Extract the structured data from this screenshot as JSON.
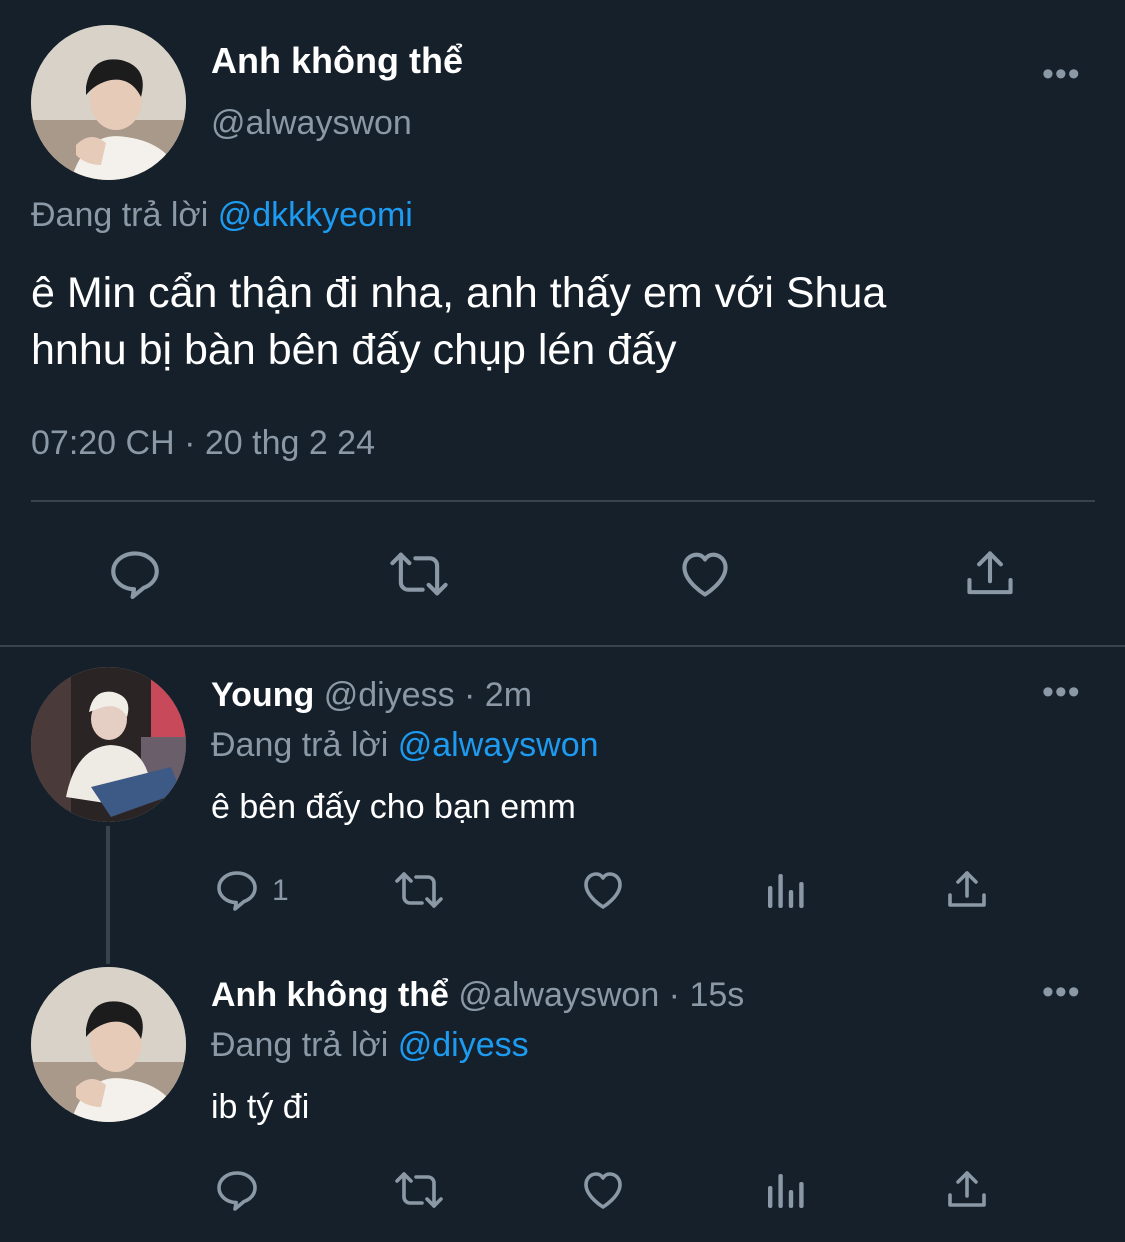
{
  "main_tweet": {
    "display_name": "Anh không thể",
    "handle": "@alwayswon",
    "replying_prefix": "Đang trả lời",
    "replying_to": "@dkkkyeomi",
    "text_line1": "ê Min cẩn thận đi nha, anh thấy em với Shua",
    "text_line2": "hnhu bị bàn bên đấy chụp lén đấy",
    "timestamp": "07:20 CH · 20 thg 2 24",
    "more_label": "•••"
  },
  "reply1": {
    "display_name": "Young",
    "meta": "@diyess · 2m",
    "replying_prefix": "Đang trả lời",
    "replying_to": "@alwayswon",
    "text": "ê bên đấy cho bạn emm",
    "reply_count": "1",
    "more_label": "•••"
  },
  "reply2": {
    "display_name": "Anh không thể",
    "meta": "@alwayswon · 15s",
    "replying_prefix": "Đang trả lời",
    "replying_to": "@diyess",
    "text": "ib tý đi",
    "more_label": "•••"
  },
  "colors": {
    "background": "#15202b",
    "muted": "#8b98a5",
    "link": "#1d9bf0",
    "divider": "#38444d"
  },
  "icons": [
    "reply-icon",
    "retweet-icon",
    "like-icon",
    "share-icon",
    "analytics-icon",
    "more-icon"
  ]
}
